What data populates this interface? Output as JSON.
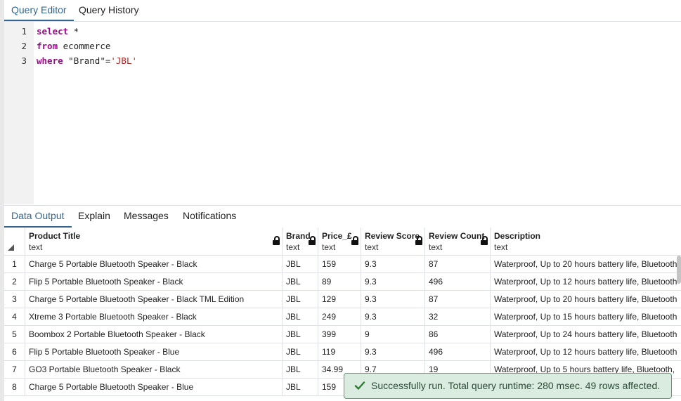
{
  "tabs_top": [
    {
      "label": "Query Editor"
    },
    {
      "label": "Query History"
    }
  ],
  "editor": {
    "line_numbers": [
      "1",
      "2",
      "3"
    ],
    "lines": [
      {
        "kw": "select",
        "rest": " *"
      },
      {
        "kw": "from",
        "rest": " ecommerce"
      },
      {
        "kw": "where",
        "rest": " \"Brand\"=",
        "str": "'JBL'"
      }
    ]
  },
  "tabs_bottom": [
    {
      "label": "Data Output"
    },
    {
      "label": "Explain"
    },
    {
      "label": "Messages"
    },
    {
      "label": "Notifications"
    }
  ],
  "grid": {
    "columns": [
      {
        "name": "Product Title",
        "type": "text"
      },
      {
        "name": "Brand",
        "type": "text"
      },
      {
        "name": "Price_£",
        "type": "text"
      },
      {
        "name": "Review Score",
        "type": "text"
      },
      {
        "name": "Review Count",
        "type": "text"
      },
      {
        "name": "Description",
        "type": "text"
      }
    ],
    "rows": [
      {
        "n": "1",
        "cells": [
          "Charge 5 Portable Bluetooth Speaker - Black",
          "JBL",
          "159",
          "9.3",
          "87",
          "Waterproof, Up to 20 hours battery life, Bluetooth"
        ]
      },
      {
        "n": "2",
        "cells": [
          "Flip 5 Portable Bluetooth Speaker - Black",
          "JBL",
          "89",
          "9.3",
          "496",
          "Waterproof, Up to 12 hours battery life, Bluetooth"
        ]
      },
      {
        "n": "3",
        "cells": [
          "Charge 5 Portable Bluetooth Speaker - Black TML Edition",
          "JBL",
          "129",
          "9.3",
          "87",
          "Waterproof, Up to 20 hours battery life, Bluetooth"
        ]
      },
      {
        "n": "4",
        "cells": [
          "Xtreme 3 Portable Bluetooth Speaker - Black",
          "JBL",
          "249",
          "9.3",
          "32",
          "Waterproof, Up to 15 hours battery life, Bluetooth"
        ]
      },
      {
        "n": "5",
        "cells": [
          "Boombox 2 Portable Bluetooth Speaker - Black",
          "JBL",
          "399",
          "9",
          "86",
          "Waterproof, Up to 24 hours battery life, Bluetooth"
        ]
      },
      {
        "n": "6",
        "cells": [
          "Flip 5 Portable Bluetooth Speaker - Blue",
          "JBL",
          "119",
          "9.3",
          "496",
          "Waterproof, Up to 12 hours battery life, Bluetooth"
        ]
      },
      {
        "n": "7",
        "cells": [
          "GO3 Portable Bluetooth Speaker - Black",
          "JBL",
          "34.99",
          "9.7",
          "19",
          "Waterproof, Up to 5 hours battery life, Bluetooth,"
        ]
      },
      {
        "n": "8",
        "cells": [
          "Charge 5 Portable Bluetooth Speaker - Blue",
          "JBL",
          "159",
          "",
          "",
          ""
        ]
      }
    ]
  },
  "toast": {
    "icon": "check-icon",
    "message": "Successfully run. Total query runtime: 280 msec. 49 rows affected."
  },
  "colors": {
    "accent": "#326690",
    "keyword": "#9a0a86",
    "string": "#b22222",
    "toast_bg": "#d9ecdf",
    "toast_border": "#5a9f6c"
  }
}
